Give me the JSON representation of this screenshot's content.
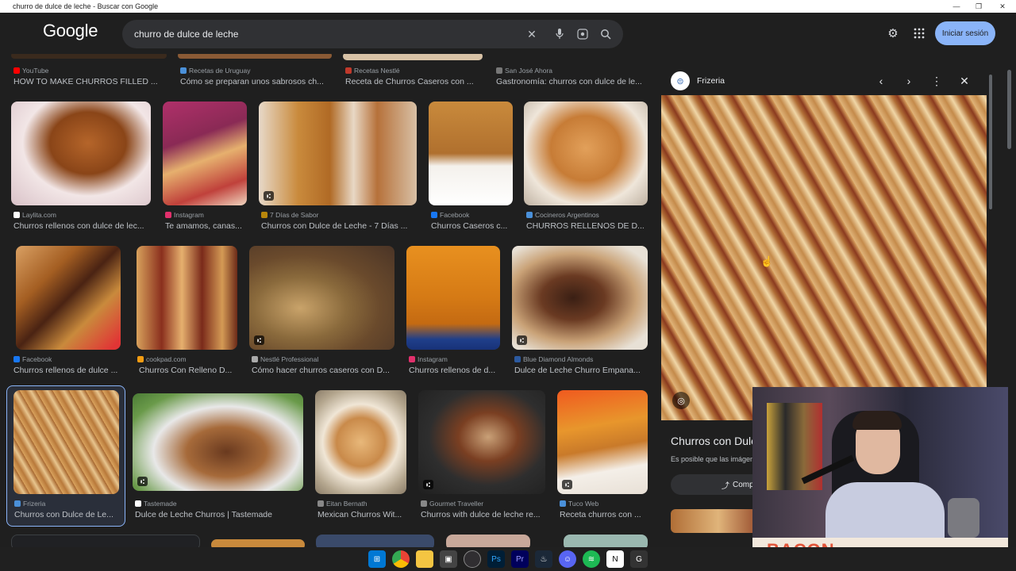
{
  "window": {
    "title": "churro de dulce de leche - Buscar con Google"
  },
  "header": {
    "logo": "Google",
    "search_value": "churro de dulce de leche",
    "signin_label": "Iniciar sesión"
  },
  "top_row": [
    {
      "source": "YouTube",
      "title": "HOW TO MAKE CHURROS FILLED ...",
      "color": "#ff0000"
    },
    {
      "source": "Recetas de Uruguay",
      "title": "Cómo se preparan unos sabrosos ch...",
      "color": "#4a90d9"
    },
    {
      "source": "Recetas Nestlé",
      "title": "Receta de Churros Caseros con ...",
      "color": "#c0392b"
    },
    {
      "source": "San José Ahora",
      "title": "Gastronomía: churros con dulce de le...",
      "color": "#777777"
    }
  ],
  "row1": [
    {
      "source": "Laylita.com",
      "title": "Churros rellenos con dulce de lec...",
      "color": "#ffffff"
    },
    {
      "source": "Instagram",
      "title": "Te amamos, canas...",
      "color": "#e1306c"
    },
    {
      "source": "7 Días de Sabor",
      "title": "Churros con Dulce de Leche - 7 Días ...",
      "color": "#b8860b"
    },
    {
      "source": "Facebook",
      "title": "Churros Caseros c...",
      "color": "#1877f2"
    },
    {
      "source": "Cocineros Argentinos",
      "title": "CHURROS RELLENOS DE D...",
      "color": "#4a90d9"
    }
  ],
  "row2": [
    {
      "source": "Facebook",
      "title": "Churros rellenos de dulce ...",
      "color": "#1877f2"
    },
    {
      "source": "cookpad.com",
      "title": "Churros Con Relleno D...",
      "color": "#f39c12"
    },
    {
      "source": "Nestlé Professional",
      "title": "Cómo hacer churros caseros con D...",
      "color": "#aaaaaa"
    },
    {
      "source": "Instagram",
      "title": "Churros rellenos de d...",
      "color": "#e1306c"
    },
    {
      "source": "Blue Diamond Almonds",
      "title": "Dulce de Leche Churro Empana...",
      "color": "#2c5aa0"
    }
  ],
  "row3": [
    {
      "source": "Frizeria",
      "title": "Churros con Dulce de Le...",
      "color": "#4a90d9"
    },
    {
      "source": "Tastemade",
      "title": "Dulce de Leche Churros | Tastemade",
      "color": "#ffffff"
    },
    {
      "source": "Eitan Bernath",
      "title": "Mexican Churros Wit...",
      "color": "#888888"
    },
    {
      "source": "Gourmet Traveller",
      "title": "Churros with dulce de leche re...",
      "color": "#888888"
    },
    {
      "source": "Tuco Web",
      "title": "Receta churros con ...",
      "color": "#4a90d9"
    }
  ],
  "panel": {
    "source": "Frizeria",
    "title": "Churros con Dulc",
    "desc": "Es posible que las imágen",
    "share_label": "Comp"
  },
  "webcam": {
    "banner": "BACON"
  },
  "colors": {
    "accent": "#8ab4f8",
    "bg": "#1f1f1f"
  }
}
